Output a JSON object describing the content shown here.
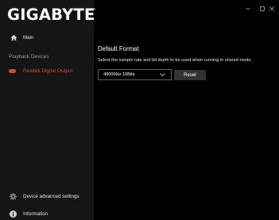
{
  "app": {
    "logo_text": "GIGABYTE",
    "logo_tm": "™",
    "window_controls": [
      "minimize-icon",
      "maximize-icon",
      "close-icon"
    ]
  },
  "sidebar": {
    "main_label": "Main",
    "main_icon": "home-icon",
    "section_label": "Playback Devices",
    "devices": [
      {
        "label": "Realtek Digital Output",
        "icon": "speaker-icon",
        "selected": true
      }
    ],
    "bottom": [
      {
        "label": "Device advanced settings",
        "icon": "gear-icon"
      },
      {
        "label": "Information",
        "icon": "info-icon"
      }
    ]
  },
  "main": {
    "title": "Default Format",
    "description": "Select the sample rate and bit depth to be used when running in shared mode.",
    "format_select": {
      "value": "48000Hz 16Bits"
    },
    "reset_label": "Reset"
  },
  "colors": {
    "accent": "#e0461f",
    "sidebar_bg": "#151515",
    "main_bg": "#000000",
    "button_bg": "#323232"
  }
}
